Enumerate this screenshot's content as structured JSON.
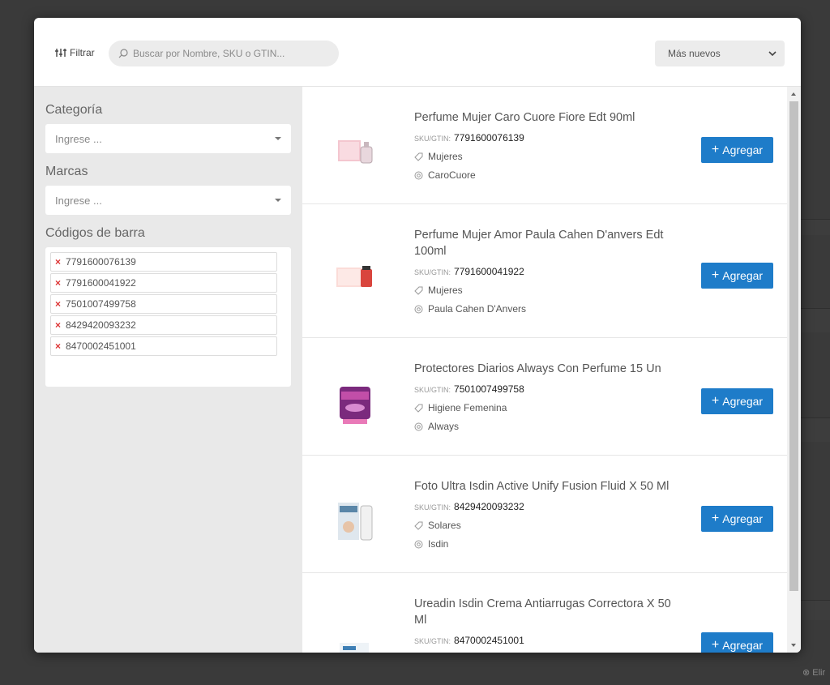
{
  "toolbar": {
    "filter_label": "Filtrar",
    "search_placeholder": "Buscar por Nombre, SKU o GTIN...",
    "sort_value": "Más nuevos"
  },
  "sidebar": {
    "category_label": "Categoría",
    "category_placeholder": "Ingrese ...",
    "brands_label": "Marcas",
    "brands_placeholder": "Ingrese ...",
    "barcodes_label": "Códigos de barra",
    "barcodes": [
      "7791600076139",
      "7791600041922",
      "7501007499758",
      "8429420093232",
      "8470002451001"
    ]
  },
  "products": [
    {
      "name": "Perfume Mujer Caro Cuore Fiore Edt 90ml",
      "sku_label": "SKU/GTIN:",
      "sku": "7791600076139",
      "category": "Mujeres",
      "brand": "CaroCuore",
      "add_label": "Agregar",
      "thumb": "pink-perfume-box"
    },
    {
      "name": "Perfume Mujer Amor Paula Cahen D'anvers Edt 100ml",
      "sku_label": "SKU/GTIN:",
      "sku": "7791600041922",
      "category": "Mujeres",
      "brand": "Paula Cahen D'Anvers",
      "add_label": "Agregar",
      "thumb": "red-perfume-box"
    },
    {
      "name": "Protectores Diarios Always Con Perfume 15 Un",
      "sku_label": "SKU/GTIN:",
      "sku": "7501007499758",
      "category": "Higiene Femenina",
      "brand": "Always",
      "add_label": "Agregar",
      "thumb": "purple-pack"
    },
    {
      "name": "Foto Ultra Isdin Active Unify Fusion Fluid X 50 Ml",
      "sku_label": "SKU/GTIN:",
      "sku": "8429420093232",
      "category": "Solares",
      "brand": "Isdin",
      "add_label": "Agregar",
      "thumb": "sunscreen-box"
    },
    {
      "name": "Ureadin Isdin Crema Antiarrugas Correctora X 50 Ml",
      "sku_label": "SKU/GTIN:",
      "sku": "8470002451001",
      "category": "",
      "brand": "",
      "add_label": "Agregar",
      "thumb": "cream-box"
    }
  ],
  "background": {
    "corner_text": "Elir"
  },
  "colors": {
    "accent": "#1e7cc9",
    "remove": "#dd3333",
    "sidebar_bg": "#e9e9e9"
  }
}
